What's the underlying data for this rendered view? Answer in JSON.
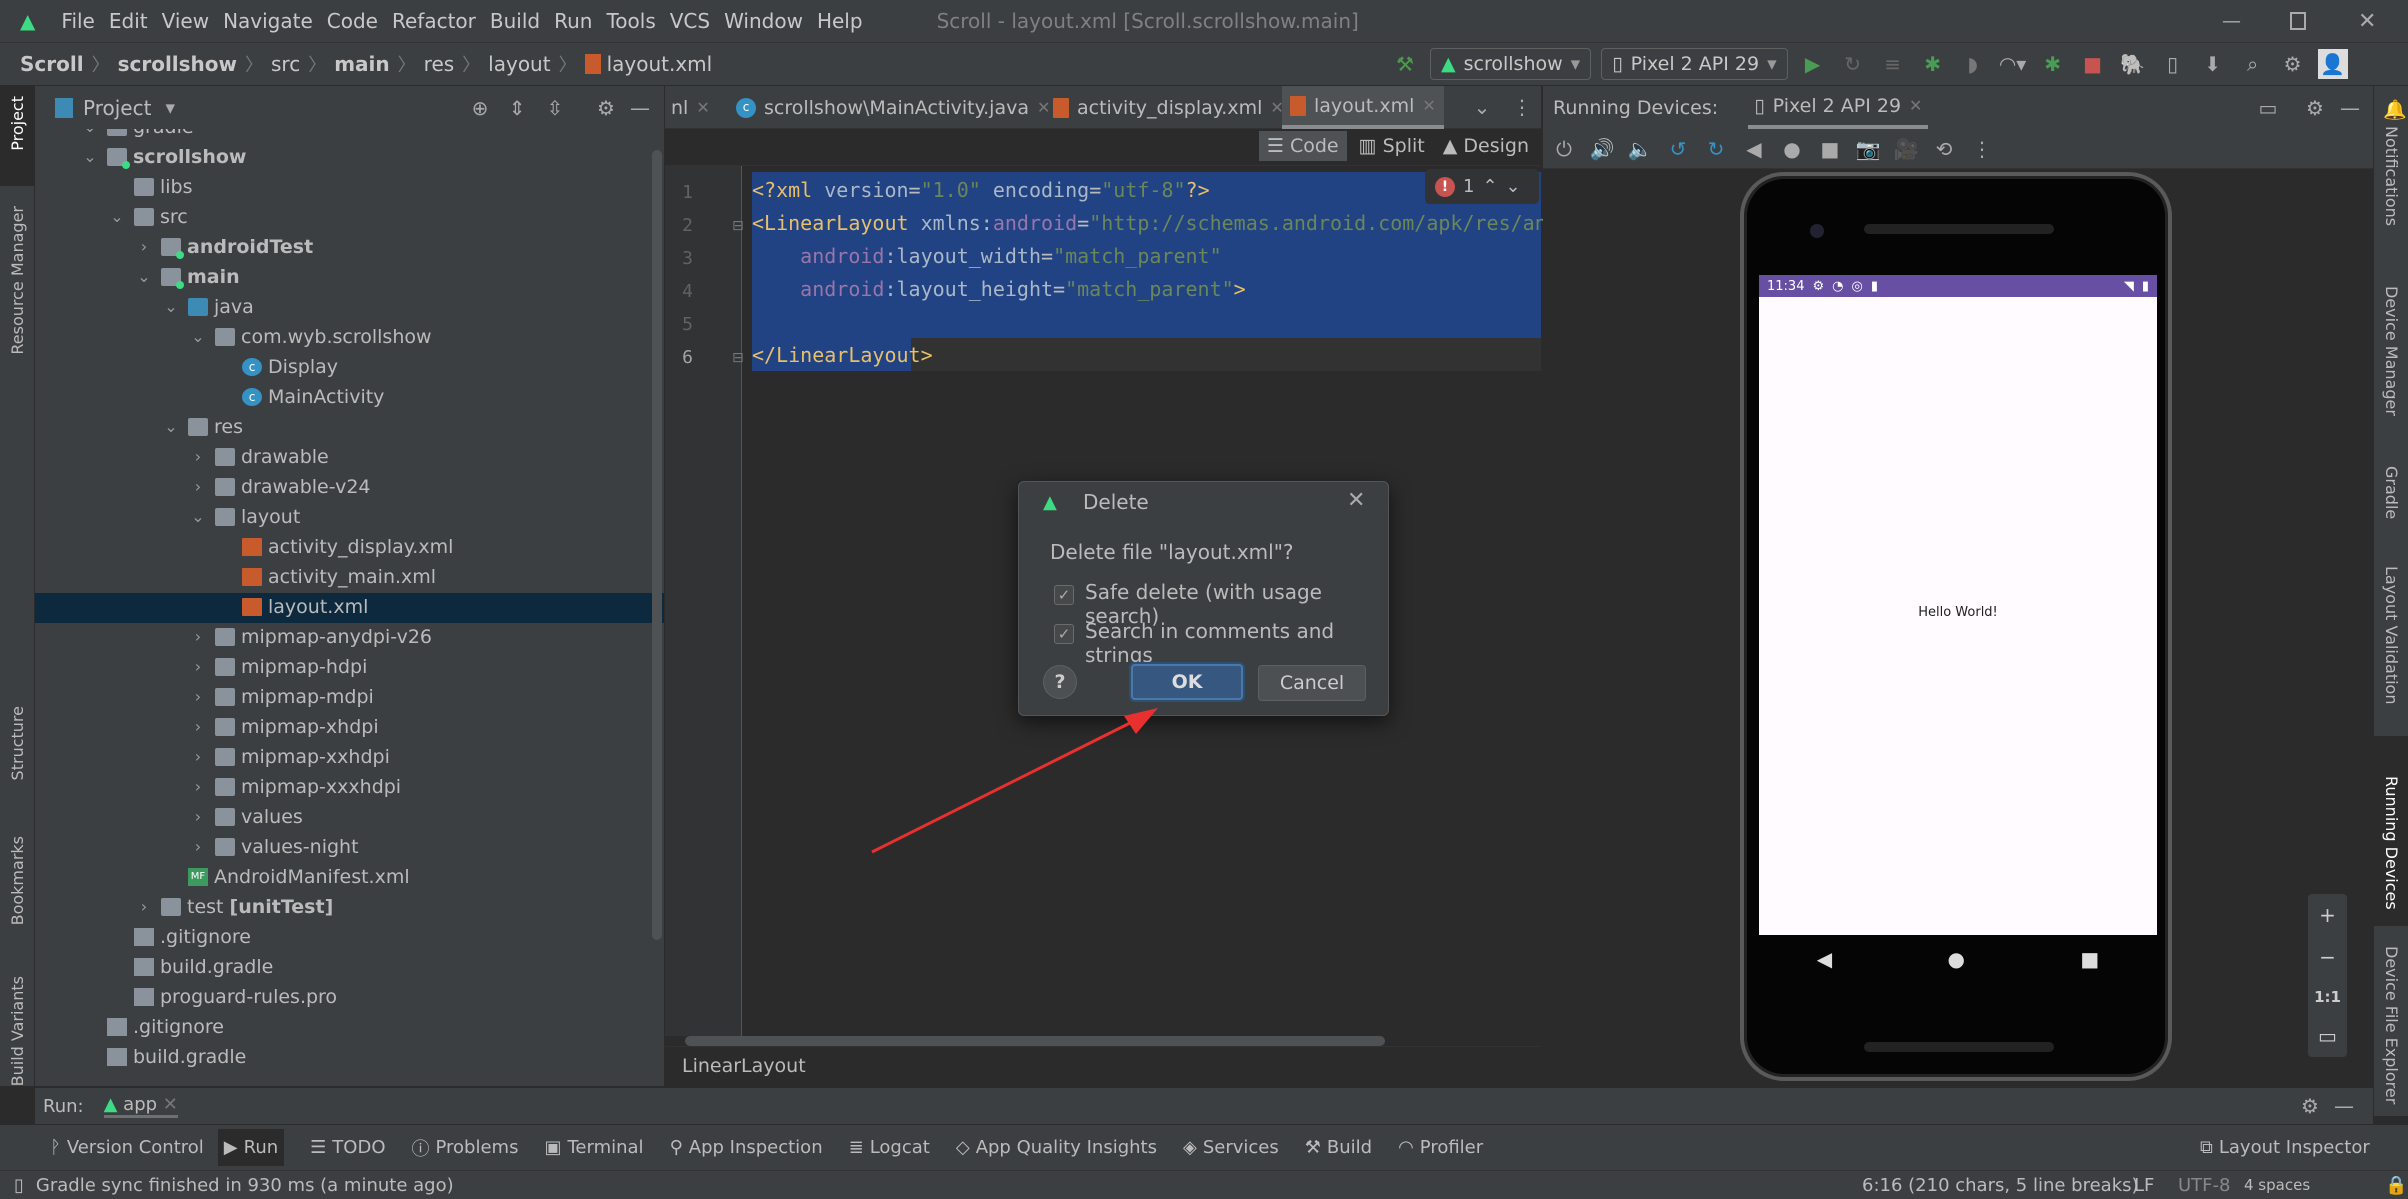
{
  "menu": {
    "items": [
      "File",
      "Edit",
      "View",
      "Navigate",
      "Code",
      "Refactor",
      "Build",
      "Run",
      "Tools",
      "VCS",
      "Window",
      "Help"
    ],
    "window_title": "Scroll - layout.xml [Scroll.scrollshow.main]"
  },
  "breadcrumb": [
    {
      "text": "Scroll",
      "bold": true
    },
    {
      "text": "scrollshow",
      "bold": true
    },
    {
      "text": "src",
      "bold": false
    },
    {
      "text": "main",
      "bold": true
    },
    {
      "text": "res",
      "bold": false
    },
    {
      "text": "layout",
      "bold": false
    },
    {
      "text": "layout.xml",
      "bold": false
    }
  ],
  "toolbar": {
    "run_config": "scrollshow",
    "device": "Pixel 2 API 29"
  },
  "left_strip": {
    "project": "Project",
    "resource_manager": "Resource Manager",
    "structure": "Structure",
    "bookmarks": "Bookmarks",
    "build_variants": "Build Variants"
  },
  "right_strip": {
    "notifications": "Notifications",
    "device_manager": "Device Manager",
    "gradle": "Gradle",
    "layout_validation": "Layout Validation",
    "running_devices": "Running Devices",
    "device_file_explorer": "Device File Explorer"
  },
  "project": {
    "title": "Project",
    "tree": [
      {
        "d": 0,
        "arrow": "open",
        "icon": "folder",
        "text": "gradle"
      },
      {
        "d": 0,
        "arrow": "open",
        "icon": "module",
        "text": "scrollshow",
        "bold": true
      },
      {
        "d": 1,
        "arrow": "",
        "icon": "folder",
        "text": "libs"
      },
      {
        "d": 1,
        "arrow": "open",
        "icon": "folder",
        "text": "src"
      },
      {
        "d": 2,
        "arrow": "closed",
        "icon": "module",
        "text": "androidTest",
        "bold": true
      },
      {
        "d": 2,
        "arrow": "open",
        "icon": "module",
        "text": "main",
        "bold": true
      },
      {
        "d": 3,
        "arrow": "open",
        "icon": "folder-blue",
        "text": "java"
      },
      {
        "d": 4,
        "arrow": "open",
        "icon": "package",
        "text": "com.wyb.scrollshow"
      },
      {
        "d": 5,
        "arrow": "",
        "icon": "class",
        "text": "Display"
      },
      {
        "d": 5,
        "arrow": "",
        "icon": "class",
        "text": "MainActivity"
      },
      {
        "d": 3,
        "arrow": "open",
        "icon": "folder",
        "text": "res"
      },
      {
        "d": 4,
        "arrow": "closed",
        "icon": "folder",
        "text": "drawable"
      },
      {
        "d": 4,
        "arrow": "closed",
        "icon": "folder",
        "text": "drawable-v24"
      },
      {
        "d": 4,
        "arrow": "open",
        "icon": "folder",
        "text": "layout"
      },
      {
        "d": 5,
        "arrow": "",
        "icon": "xml",
        "text": "activity_display.xml"
      },
      {
        "d": 5,
        "arrow": "",
        "icon": "xml",
        "text": "activity_main.xml"
      },
      {
        "d": 5,
        "arrow": "",
        "icon": "xml",
        "text": "layout.xml",
        "selected": true
      },
      {
        "d": 4,
        "arrow": "closed",
        "icon": "folder",
        "text": "mipmap-anydpi-v26"
      },
      {
        "d": 4,
        "arrow": "closed",
        "icon": "folder",
        "text": "mipmap-hdpi"
      },
      {
        "d": 4,
        "arrow": "closed",
        "icon": "folder",
        "text": "mipmap-mdpi"
      },
      {
        "d": 4,
        "arrow": "closed",
        "icon": "folder",
        "text": "mipmap-xhdpi"
      },
      {
        "d": 4,
        "arrow": "closed",
        "icon": "folder",
        "text": "mipmap-xxhdpi"
      },
      {
        "d": 4,
        "arrow": "closed",
        "icon": "folder",
        "text": "mipmap-xxxhdpi"
      },
      {
        "d": 4,
        "arrow": "closed",
        "icon": "folder",
        "text": "values"
      },
      {
        "d": 4,
        "arrow": "closed",
        "icon": "folder",
        "text": "values-night"
      },
      {
        "d": 3,
        "arrow": "",
        "icon": "manifest",
        "text": "AndroidManifest.xml"
      },
      {
        "d": 2,
        "arrow": "closed",
        "icon": "test-folder",
        "text": "test ",
        "suffix": "[unitTest]"
      },
      {
        "d": 1,
        "arrow": "",
        "icon": "gitignore",
        "text": ".gitignore"
      },
      {
        "d": 1,
        "arrow": "",
        "icon": "gradle",
        "text": "build.gradle"
      },
      {
        "d": 1,
        "arrow": "",
        "icon": "file",
        "text": "proguard-rules.pro"
      },
      {
        "d": 0,
        "arrow": "",
        "icon": "gitignore",
        "text": ".gitignore"
      },
      {
        "d": 0,
        "arrow": "",
        "icon": "gradle",
        "text": "build.gradle"
      }
    ]
  },
  "editor": {
    "tabs": [
      {
        "label": "nl",
        "partial": true
      },
      {
        "label": "scrollshow\\MainActivity.java",
        "icon": "class"
      },
      {
        "label": "activity_display.xml",
        "icon": "xml"
      },
      {
        "label": "layout.xml",
        "icon": "xml",
        "active": true
      }
    ],
    "modes": [
      "Code",
      "Split",
      "Design"
    ],
    "line_numbers": [
      "1",
      "2",
      "3",
      "4",
      "5",
      "6"
    ],
    "error_count": "1",
    "code": {
      "l1": [
        "<?xml ",
        "version",
        "=",
        "\"1.0\"",
        " encoding",
        "=",
        "\"utf-8\"",
        "?>"
      ],
      "l2": [
        "<LinearLayout",
        " xmlns:",
        "android",
        "=",
        "\"http://schemas.android.com/apk/res/an"
      ],
      "l3": [
        "android",
        ":layout_width",
        "=",
        "\"match_parent\""
      ],
      "l4": [
        "android",
        ":layout_height",
        "=",
        "\"match_parent\"",
        ">"
      ],
      "l6": [
        "</LinearLayout>"
      ]
    },
    "breadcrumb": "LinearLayout"
  },
  "devices": {
    "label": "Running Devices:",
    "tab": "Pixel 2 API 29",
    "status_time": "11:34",
    "hello": "Hello World!",
    "zoom_fit": "1:1"
  },
  "dialog": {
    "title": "Delete",
    "question": "Delete file \"layout.xml\"?",
    "safe_delete": "Safe delete (with usage search)",
    "safe_delete_checked": true,
    "search_comments": "Search in comments and strings",
    "search_comments_checked": true,
    "help": "?",
    "ok": "OK",
    "cancel": "Cancel"
  },
  "run": {
    "label": "Run:",
    "config": "app"
  },
  "bottom_tools": [
    "Version Control",
    "Run",
    "TODO",
    "Problems",
    "Terminal",
    "App Inspection",
    "Logcat",
    "App Quality Insights",
    "Services",
    "Build",
    "Profiler"
  ],
  "layout_inspector": "Layout Inspector",
  "status": {
    "message": "Gradle sync finished in 930 ms (a minute ago)",
    "position": "6:16 (210 chars, 5 line breaks)",
    "line_sep": "LF",
    "encoding": "UTF-8",
    "indent": "4 spaces"
  },
  "colors": {
    "accent": "#365880",
    "selection": "#214283",
    "android_green": "#3ddc84",
    "annotation_arrow": "#e8312f",
    "status_bar": "#6750a4"
  }
}
